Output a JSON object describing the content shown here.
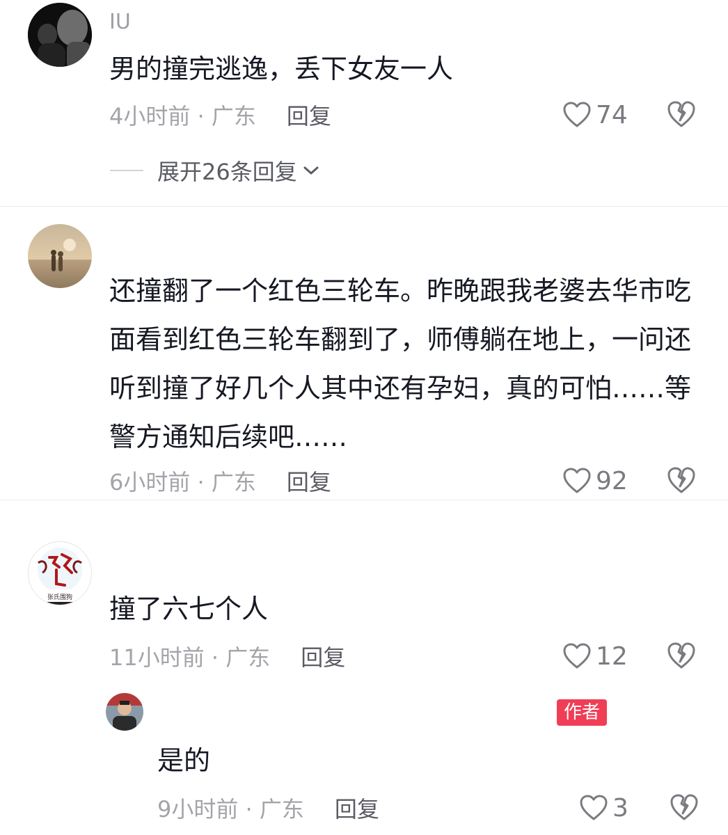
{
  "comments": [
    {
      "username": "IU",
      "text": "男的撞完逃逸，丢下女友一人",
      "time_location": "4小时前 · 广东",
      "reply_label": "回复",
      "likes": "74",
      "expand_label": "展开26条回复"
    },
    {
      "username": "",
      "text": "还撞翻了一个红色三轮车。昨晚跟我老婆去华市吃面看到红色三轮车翻到了，师傅躺在地上，一问还听到撞了好几个人其中还有孕妇，真的可怕……等警方通知后续吧……",
      "time_location": "6小时前 · 广东",
      "reply_label": "回复",
      "likes": "92"
    },
    {
      "username": "",
      "text": "撞了六七个人",
      "time_location": "11小时前 · 广东",
      "reply_label": "回复",
      "likes": "12",
      "avatar_text": "张氏围狗",
      "reply": {
        "badge": "作者",
        "text": "是的",
        "time_location": "9小时前 · 广东",
        "reply_label": "回复",
        "likes": "3"
      }
    }
  ],
  "icons": {
    "like": "heart-outline-icon",
    "dislike": "broken-heart-icon",
    "expand": "chevron-down-icon"
  },
  "colors": {
    "text": "#161823",
    "meta": "#a3a4a9",
    "author_badge": "#f03e57"
  }
}
